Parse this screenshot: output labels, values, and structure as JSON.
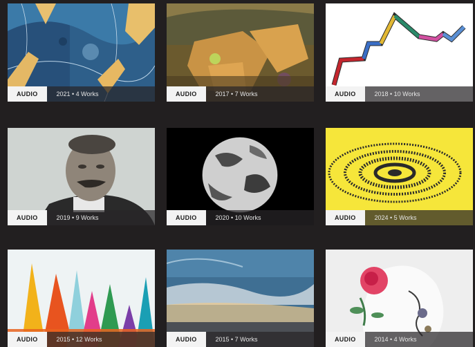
{
  "collections": [
    {
      "badge": "AUDIO",
      "meta": "2021 • 4 Works"
    },
    {
      "badge": "AUDIO",
      "meta": "2017 • 7 Works"
    },
    {
      "badge": "AUDIO",
      "meta": "2018 • 10 Works"
    },
    {
      "badge": "AUDIO",
      "meta": "2019 • 9 Works"
    },
    {
      "badge": "AUDIO",
      "meta": "2020 • 10 Works"
    },
    {
      "badge": "AUDIO",
      "meta": "2024 • 5 Works"
    },
    {
      "badge": "AUDIO",
      "meta": "2015 • 12 Works"
    },
    {
      "badge": "AUDIO",
      "meta": "2015 • 7 Works"
    },
    {
      "badge": "AUDIO",
      "meta": "2014 • 4 Works"
    }
  ],
  "colors": {
    "page_background": "#221f20",
    "badge_background": "#f3f3f3",
    "accent_yellow": "#f6e63a"
  }
}
